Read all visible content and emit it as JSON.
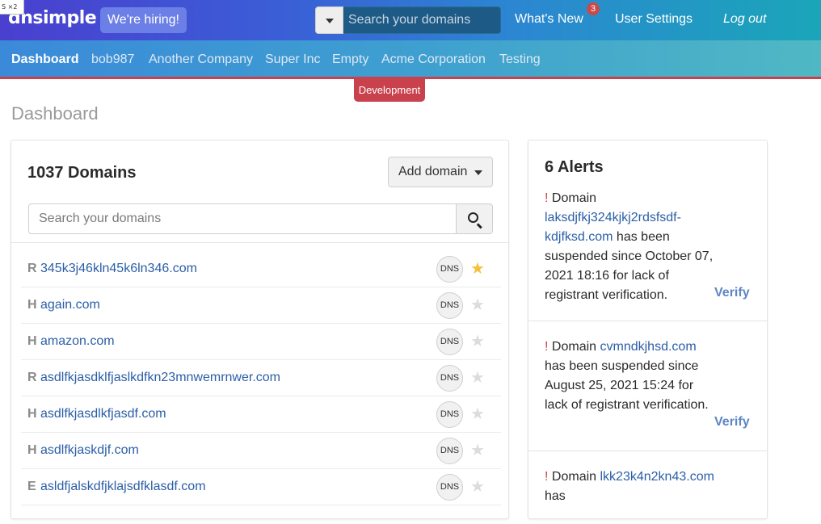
{
  "corner_tag": "S  ×2",
  "header": {
    "logo": "dnsimple",
    "hiring": "We're hiring!",
    "search_placeholder": "Search your domains",
    "whats_new": "What's New",
    "whats_new_count": "3",
    "user_settings": "User Settings",
    "logout": "Log out"
  },
  "accounts": {
    "items": [
      "Dashboard",
      "bob987",
      "Another Company",
      "Super Inc",
      "Empty",
      "Acme Corporation",
      "Testing"
    ],
    "active": "Dashboard",
    "environment": "Development"
  },
  "colors": {
    "accent_link": "#2b5ea7",
    "environment_red": "#c9414c",
    "favorite_star": "#f4c13d"
  },
  "page": {
    "title": "Dashboard"
  },
  "domains": {
    "title": "1037 Domains",
    "add_button": "Add domain",
    "search_placeholder": "Search your domains",
    "dns_label": "DNS",
    "rows": [
      {
        "type": "R",
        "name": "345k3j46kln45k6ln346.com",
        "favorite": true
      },
      {
        "type": "H",
        "name": "again.com",
        "favorite": false
      },
      {
        "type": "H",
        "name": "amazon.com",
        "favorite": false
      },
      {
        "type": "R",
        "name": "asdlfkjasdklfjaslkdfkn23mnwemrnwer.com",
        "favorite": false
      },
      {
        "type": "H",
        "name": "asdlfkjasdlkfjasdf.com",
        "favorite": false
      },
      {
        "type": "H",
        "name": "asdlfkjaskdjf.com",
        "favorite": false
      },
      {
        "type": "E",
        "name": "asldfjalskdfjklajsdfklasdf.com",
        "favorite": false
      }
    ]
  },
  "alerts": {
    "title": "6 Alerts",
    "verify_label": "Verify",
    "items": [
      {
        "prefix": "Domain",
        "domain": "laksdjfkj324kjkj2rdsfsdf-kdjfksd.com",
        "message": "has been suspended since October 07, 2021 18:16 for lack of registrant verification."
      },
      {
        "prefix": "Domain",
        "domain": "cvmndkjhsd.com",
        "message": "has been suspended since August 25, 2021 15:24 for lack of registrant verification."
      },
      {
        "prefix": "Domain",
        "domain": "lkk23k4n2kn43.com",
        "message": "has"
      }
    ]
  }
}
